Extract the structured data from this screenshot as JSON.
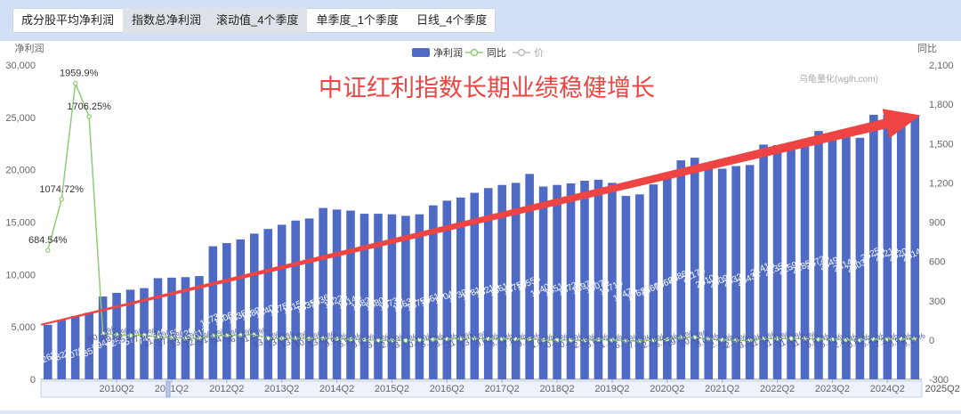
{
  "tabs_metric": [
    {
      "label": "成分股平均净利润",
      "active": false
    },
    {
      "label": "指数总净利润",
      "active": true
    }
  ],
  "tabs_mode": [
    {
      "label": "滚动值_4个季度",
      "active": true
    },
    {
      "label": "单季度_1个季度",
      "active": false
    },
    {
      "label": "日线_4个季度",
      "active": false
    }
  ],
  "colors": {
    "bar": "#4e6ac4",
    "yoy": "#91cc75",
    "price": "#bdbdbd",
    "arrow": "#ee4444",
    "headline": "#ee4444"
  },
  "chart_data": {
    "type": "bar",
    "headline": "中证红利指数长期业绩稳健增长",
    "watermark": "乌龟量化(wglh.com)",
    "ylabel": "净利润",
    "y2label": "同比",
    "ylim": [
      0,
      30000
    ],
    "y2lim": [
      -300,
      2100
    ],
    "yticks": [
      0,
      5000,
      10000,
      15000,
      20000,
      25000,
      30000
    ],
    "y2ticks": [
      -300,
      0,
      300,
      600,
      900,
      1200,
      1500,
      1800,
      2100
    ],
    "legend": [
      {
        "name": "净利润",
        "symbol": "bar"
      },
      {
        "name": "同比",
        "symbol": "line"
      },
      {
        "name": "价",
        "symbol": "line-muted"
      }
    ],
    "xtick_labels": [
      "2010Q2",
      "2011Q2",
      "2012Q2",
      "2013Q2",
      "2014Q2",
      "2015Q2",
      "2016Q2",
      "2017Q2",
      "2018Q2",
      "2019Q2",
      "2020Q2",
      "2021Q2",
      "2022Q2",
      "2023Q2",
      "2024Q2",
      "2025Q2"
    ],
    "first_quarter": "2009Q1",
    "series": [
      {
        "name": "净利润",
        "axis": "left",
        "values": [
          5200,
          5650,
          6050,
          6350,
          7900,
          8250,
          8550,
          8700,
          9650,
          9700,
          9750,
          9850,
          12700,
          13000,
          13350,
          13900,
          14350,
          14750,
          15150,
          15350,
          16350,
          16200,
          16100,
          15800,
          15800,
          15750,
          15600,
          15750,
          16600,
          17050,
          17350,
          17800,
          18250,
          18550,
          18750,
          19600,
          18400,
          18550,
          18700,
          18950,
          19050,
          18750,
          17500,
          17650,
          18600,
          19650,
          20900,
          21150,
          20100,
          20100,
          20350,
          20450,
          22400,
          22350,
          22600,
          22850,
          23700,
          23500,
          23150,
          23050,
          25250,
          25250,
          25200,
          25150
        ],
        "labels": [
          "5263",
          "5822",
          "6070",
          "6351",
          "7942",
          "8254",
          "8577",
          "8742",
          "9646",
          "9653",
          "9720",
          "9813",
          "12730",
          "13062",
          "13355",
          "13896",
          "14401",
          "14757",
          "15153",
          "15355",
          "16361",
          "16224",
          "16146",
          "15822",
          "15802",
          "15738",
          "15635",
          "15756",
          "16618",
          "17047",
          "17394",
          "17818",
          "18216",
          "18618",
          "18756",
          "19558",
          "18407",
          "18512",
          "18729",
          "18970",
          "19078",
          "18718",
          "17478",
          "17624",
          "18606",
          "19681",
          "20860",
          "21174",
          "20104",
          "20097",
          "20327",
          "20432",
          "22413",
          "22358",
          "22598",
          "22852",
          "23728",
          "23497",
          "23143",
          "23037",
          "25253",
          "25215",
          "25207",
          "25143"
        ]
      },
      {
        "name": "同比",
        "axis": "right",
        "values": [
          684.54,
          1074.72,
          1959.9,
          1706.25,
          50.43,
          39.34,
          35.21,
          37.62,
          21.43,
          17.59,
          13.35,
          12.27,
          31.97,
          34.43,
          36.64,
          41.59,
          13.13,
          13.03,
          13.46,
          10.5,
          13.6,
          9.95,
          6.55,
          3.05,
          -3.42,
          -2.99,
          -3.17,
          -0.42,
          5.17,
          8.32,
          11.25,
          13.09,
          9.62,
          9.21,
          7.82,
          9.75,
          1.05,
          -0.57,
          -0.15,
          -2.99,
          3.65,
          1.11,
          -6.68,
          -7.09,
          -2.48,
          5.15,
          19.36,
          20.13,
          8.04,
          2.12,
          -2.56,
          -3.5,
          11.49,
          11.26,
          11.17,
          11.85,
          5.87,
          5.1,
          2.41,
          0.81,
          6.42,
          7.31,
          8.92,
          9.14
        ],
        "labels": [
          "684.54%",
          "1074.72%",
          "1959.9%",
          "1706.25%",
          "50.43%",
          "39.34%",
          "35.21%",
          "37.62%",
          "21.43%",
          "17.59%",
          "13.35%",
          "12.27%",
          "31.97%",
          "34.43%",
          "36.64%",
          "41.59%",
          "13.13%",
          "13.03%",
          "13.46%",
          "10.50%",
          "13.60%",
          "9.95%",
          "6.55%",
          "3.05%",
          "-3.42%",
          "-2.99%",
          "-3.17%",
          "-0.42%",
          "5.17%",
          "8.32%",
          "11.25%",
          "13.09%",
          "9.62%",
          "9.21%",
          "7.82%",
          "9.75%",
          "1.05%",
          "-0.57%",
          "-0.15%",
          "-2.99%",
          "3.65%",
          "1.11%",
          "-6.68%",
          "-7.09%",
          "-2.48%",
          "5.15%",
          "19.36%",
          "20.13%",
          "8.04%",
          "2.12%",
          "-2.56%",
          "-3.50%",
          "11.49%",
          "11.26%",
          "11.17%",
          "11.85%",
          "5.87%",
          "5.10%",
          "2.41%",
          "0.81%",
          "6.42%",
          "7.31%",
          "8.92%",
          "9.14%"
        ]
      }
    ],
    "trend_arrow": {
      "from": [
        0,
        5200
      ],
      "to": [
        63,
        25200
      ]
    },
    "grid": false,
    "legend_position": "top-center"
  }
}
